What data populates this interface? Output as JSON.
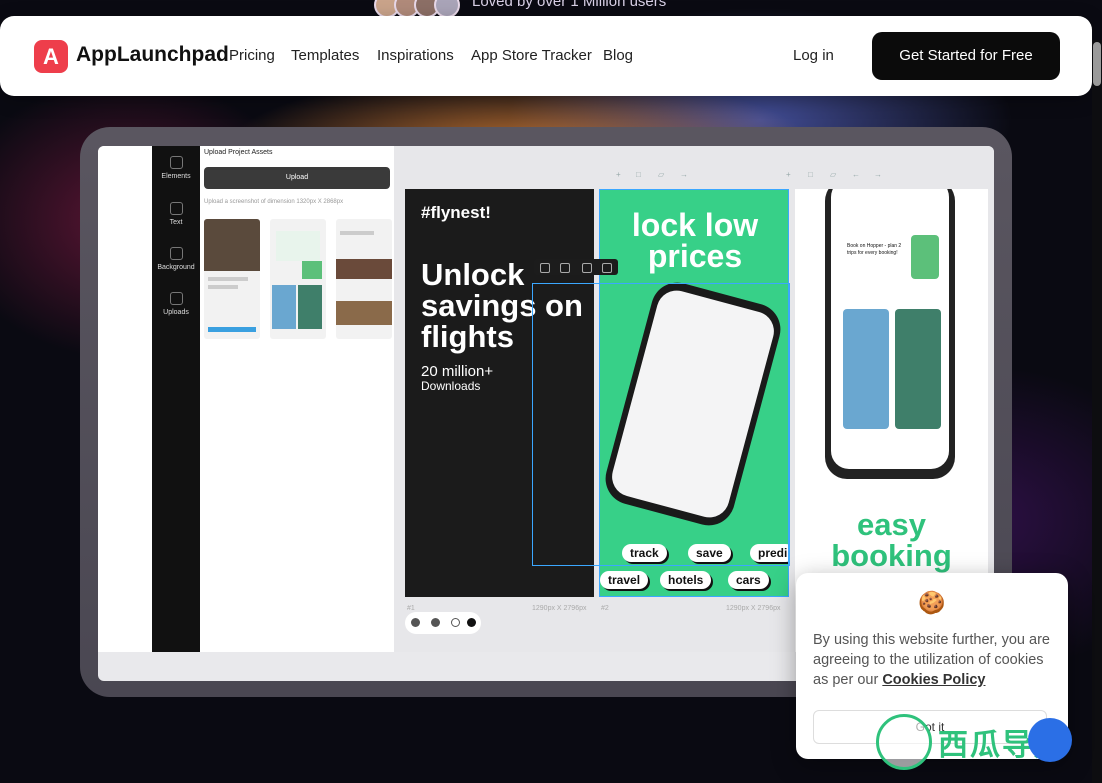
{
  "top_banner": {
    "text": "Loved by over 1 Million users"
  },
  "nav": {
    "logo_letter": "A",
    "brand": "AppLaunchpad",
    "links": [
      "Pricing",
      "Templates",
      "Inspirations",
      "App Store Tracker",
      "Blog"
    ],
    "login": "Log in",
    "cta": "Get Started for Free"
  },
  "editor": {
    "sidebar": [
      "Elements",
      "Text",
      "Background",
      "Uploads"
    ],
    "panel_title": "Upload Project Assets",
    "upload_button": "Upload",
    "upload_hint": "Upload a screenshot of dimension 1320px X 2868px",
    "art1": {
      "brand": "#flynest!",
      "headline": "Unlock savings on flights",
      "stat": "20 million+",
      "stat_sub": "Downloads"
    },
    "art2": {
      "headline": "lock low prices",
      "pills_row1": [
        "track",
        "save",
        "predi"
      ],
      "pills_row2": [
        "travel",
        "hotels",
        "cars"
      ]
    },
    "art3": {
      "headline": "easy booking",
      "card_text": "Book on Hopper - plan 2 trips for every booking!"
    },
    "captions": [
      "#1",
      "1290px X 2796px",
      "#2",
      "1290px X 2796px"
    ]
  },
  "cookie": {
    "text_before": "By using this website further, you are agreeing to the utilization of cookies as per our ",
    "link": "Cookies Policy",
    "button": "Got it"
  },
  "watermark": {
    "text": "西瓜导航"
  },
  "colors": {
    "accent_red": "#ee3e4b",
    "green": "#37d088",
    "dark": "#0b0b0b",
    "selection_blue": "#3ba7ff"
  }
}
